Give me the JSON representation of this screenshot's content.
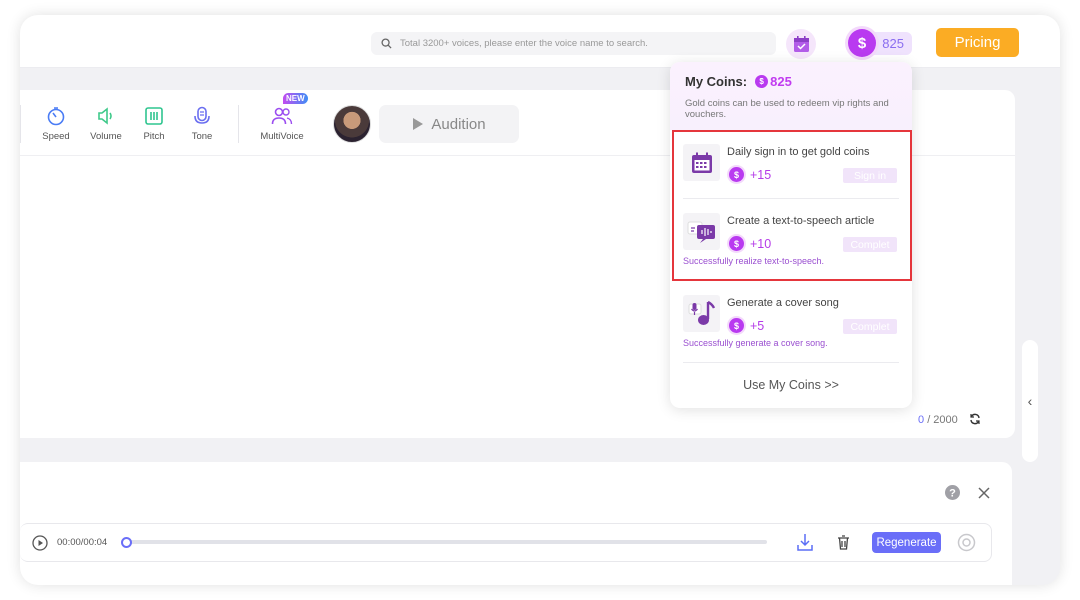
{
  "header": {
    "search_placeholder": "Total 3200+ voices, please enter the voice name to search.",
    "coins": "825",
    "pricing_label": "Pricing"
  },
  "toolbar": {
    "items": [
      {
        "label": "Speed",
        "color": "#4a7cf5"
      },
      {
        "label": "Volume",
        "color": "#3fc98a"
      },
      {
        "label": "Pitch",
        "color": "#2fc58f"
      },
      {
        "label": "Tone",
        "color": "#6a6ef0"
      },
      {
        "label": "MultiVoice",
        "color": "#9b4cf0",
        "badge": "NEW"
      }
    ],
    "audition_label": "Audition"
  },
  "editor": {
    "count": "0",
    "max": "/ 2000"
  },
  "player": {
    "time": "00:00/00:04",
    "progress": 0,
    "regenerate_label": "Regenerate",
    "accent": "#6a6ef8"
  },
  "popup": {
    "title": "My Coins:",
    "coins": "825",
    "description": "Gold coins can be used to redeem vip rights and vouchers.",
    "tasks": [
      {
        "title": "Daily sign in to get gold coins",
        "reward": "+15",
        "button": "Sign in",
        "icon": "calendar-icon"
      },
      {
        "title": "Create a text-to-speech article",
        "reward": "+10",
        "button": "Complet",
        "note": "Successfully realize text-to-speech.",
        "icon": "speech-bubble-icon"
      },
      {
        "title": "Generate a cover song",
        "reward": "+5",
        "button": "Complet",
        "note": "Successfully generate a cover song.",
        "icon": "music-note-icon"
      }
    ],
    "use_coins_label": "Use My Coins >>"
  }
}
